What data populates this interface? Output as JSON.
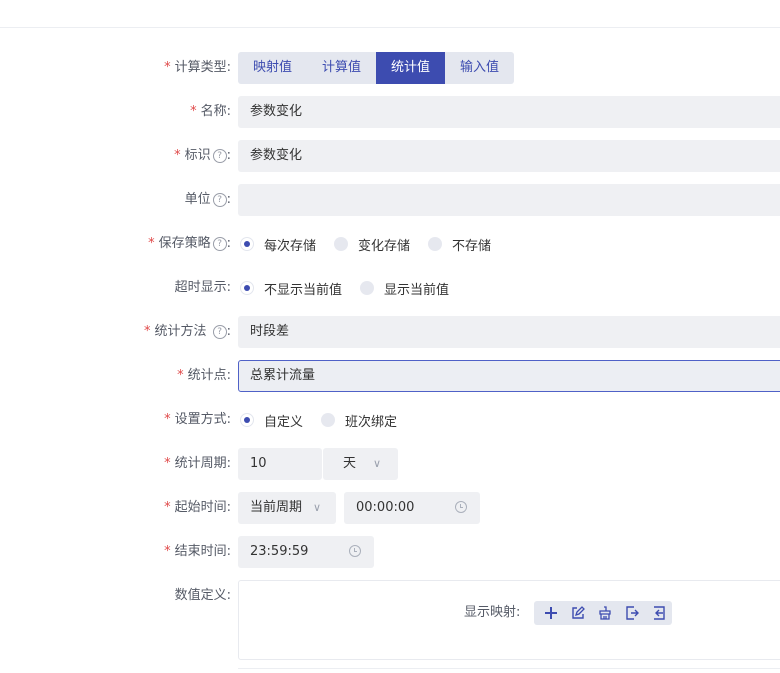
{
  "form": {
    "calc_type": {
      "label": "计算类型:",
      "options": [
        "映射值",
        "计算值",
        "统计值",
        "输入值"
      ],
      "selected": "统计值"
    },
    "name": {
      "label": "名称:",
      "value": "参数变化"
    },
    "identifier": {
      "label": "标识",
      "help": "?",
      "colon": ":",
      "value": "参数变化"
    },
    "unit": {
      "label": "单位",
      "help": "?",
      "colon": ":",
      "value": ""
    },
    "save_strategy": {
      "label": "保存策略",
      "help": "?",
      "colon": ":",
      "options": [
        "每次存储",
        "变化存储",
        "不存储"
      ],
      "selected": "每次存储"
    },
    "timeout_display": {
      "label": "超时显示:",
      "options": [
        "不显示当前值",
        "显示当前值"
      ],
      "selected": "不显示当前值"
    },
    "stat_method": {
      "label": "统计方法",
      "help": "?",
      "colon": ":",
      "value": "时段差"
    },
    "stat_point": {
      "label": "统计点:",
      "value": "总累计流量"
    },
    "setting_mode": {
      "label": "设置方式:",
      "options": [
        "自定义",
        "班次绑定"
      ],
      "selected": "自定义"
    },
    "stat_period": {
      "label": "统计周期:",
      "value": "10",
      "unit": "天"
    },
    "start_time": {
      "label": "起始时间:",
      "period": "当前周期",
      "time": "00:00:00"
    },
    "end_time": {
      "label": "结束时间:",
      "time": "23:59:59"
    },
    "value_def": {
      "label": "数值定义:",
      "map_label": "显示映射:"
    }
  },
  "required_mark": "*",
  "colors": {
    "accent": "#3d4cb0",
    "required": "#e04848",
    "field_bg": "#eff0f3"
  }
}
